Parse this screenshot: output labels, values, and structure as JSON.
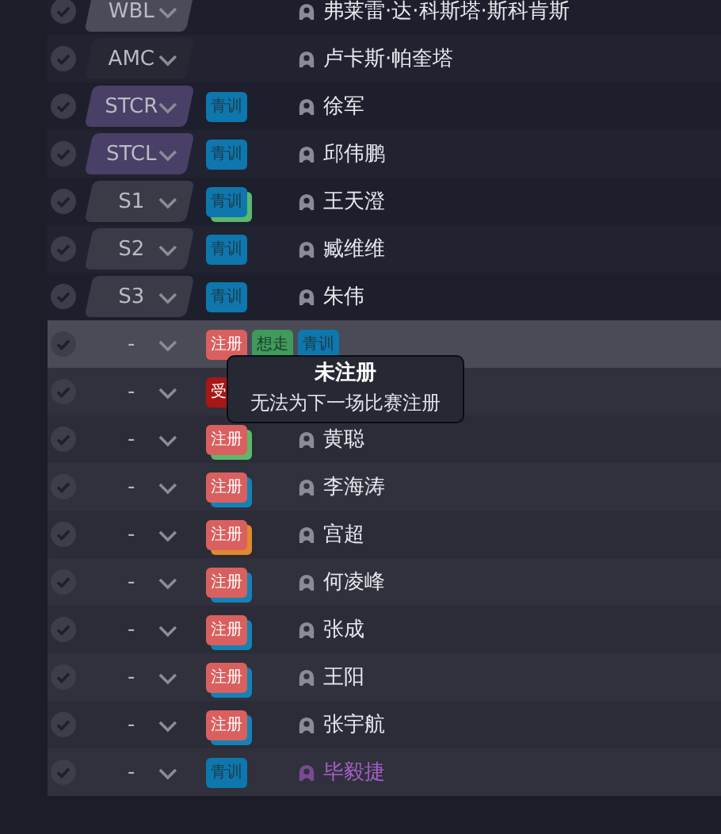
{
  "rows": [
    {
      "position": {
        "text": "WBL",
        "color": "#4a4c59"
      },
      "tags": [],
      "name": "弗莱雷·达·科斯塔·斯科肯斯",
      "hovered": false
    },
    {
      "position": {
        "text": "AMC",
        "color": "#272834"
      },
      "tags": [],
      "name": "卢卡斯·帕奎塔",
      "hovered": false
    },
    {
      "position": {
        "text": "STCR",
        "color": "#4a3f66"
      },
      "tags": [
        {
          "kind": "youth",
          "text": "青训"
        }
      ],
      "name": "徐军",
      "hovered": false
    },
    {
      "position": {
        "text": "STCL",
        "color": "#4a3f66"
      },
      "tags": [
        {
          "kind": "youth",
          "text": "青训"
        }
      ],
      "name": "邱伟鹏",
      "hovered": false
    },
    {
      "position": {
        "text": "S1",
        "color": "#3a3b47"
      },
      "tags": [
        {
          "kind": "youth",
          "text": "青训",
          "behind": {
            "color": "#5cb86c"
          }
        }
      ],
      "name": "王天澄",
      "hovered": false
    },
    {
      "position": {
        "text": "S2",
        "color": "#3a3b47"
      },
      "tags": [
        {
          "kind": "youth",
          "text": "青训"
        }
      ],
      "name": "臧维维",
      "hovered": false
    },
    {
      "position": {
        "text": "S3",
        "color": "#3a3b47"
      },
      "tags": [
        {
          "kind": "youth",
          "text": "青训"
        }
      ],
      "name": "朱伟",
      "hovered": false
    },
    {
      "position": {
        "text": "-"
      },
      "tags": [
        {
          "kind": "register",
          "text": "注册"
        },
        {
          "kind": "leave",
          "text": "想走"
        },
        {
          "kind": "youth",
          "text": "青训"
        }
      ],
      "hovered": true
    },
    {
      "position": {
        "text": "-"
      },
      "tags": [
        {
          "kind": "injury",
          "text": "受"
        }
      ],
      "hovered": false
    },
    {
      "position": {
        "text": "-"
      },
      "tags": [
        {
          "kind": "register",
          "text": "注册",
          "behind": {
            "color": "#5cb86c"
          }
        }
      ],
      "name": "黄聪",
      "hovered": false
    },
    {
      "position": {
        "text": "-"
      },
      "tags": [
        {
          "kind": "register",
          "text": "注册",
          "behind": {
            "color": "#1482b8"
          }
        }
      ],
      "name": "李海涛",
      "hovered": false
    },
    {
      "position": {
        "text": "-"
      },
      "tags": [
        {
          "kind": "register",
          "text": "注册",
          "behind": {
            "color": "#e08a2c"
          }
        }
      ],
      "name": "宫超",
      "hovered": false
    },
    {
      "position": {
        "text": "-"
      },
      "tags": [
        {
          "kind": "register",
          "text": "注册",
          "behind": {
            "color": "#1482b8"
          }
        }
      ],
      "name": "何凌峰",
      "hovered": false
    },
    {
      "position": {
        "text": "-"
      },
      "tags": [
        {
          "kind": "register",
          "text": "注册",
          "behind": {
            "color": "#1482b8"
          }
        }
      ],
      "name": "张成",
      "hovered": false
    },
    {
      "position": {
        "text": "-"
      },
      "tags": [
        {
          "kind": "register",
          "text": "注册",
          "behind": {
            "color": "#1482b8"
          }
        }
      ],
      "name": "王阳",
      "hovered": false
    },
    {
      "position": {
        "text": "-"
      },
      "tags": [
        {
          "kind": "register",
          "text": "注册",
          "behind": {
            "color": "#1482b8"
          }
        }
      ],
      "name": "张宇航",
      "hovered": false
    },
    {
      "position": {
        "text": "-"
      },
      "tags": [
        {
          "kind": "youth",
          "text": "青训"
        }
      ],
      "name": "毕毅捷",
      "color": "#a65fc8",
      "hovered": false
    }
  ],
  "tooltip": {
    "title": "未注册",
    "text": "无法为下一场比赛注册"
  }
}
